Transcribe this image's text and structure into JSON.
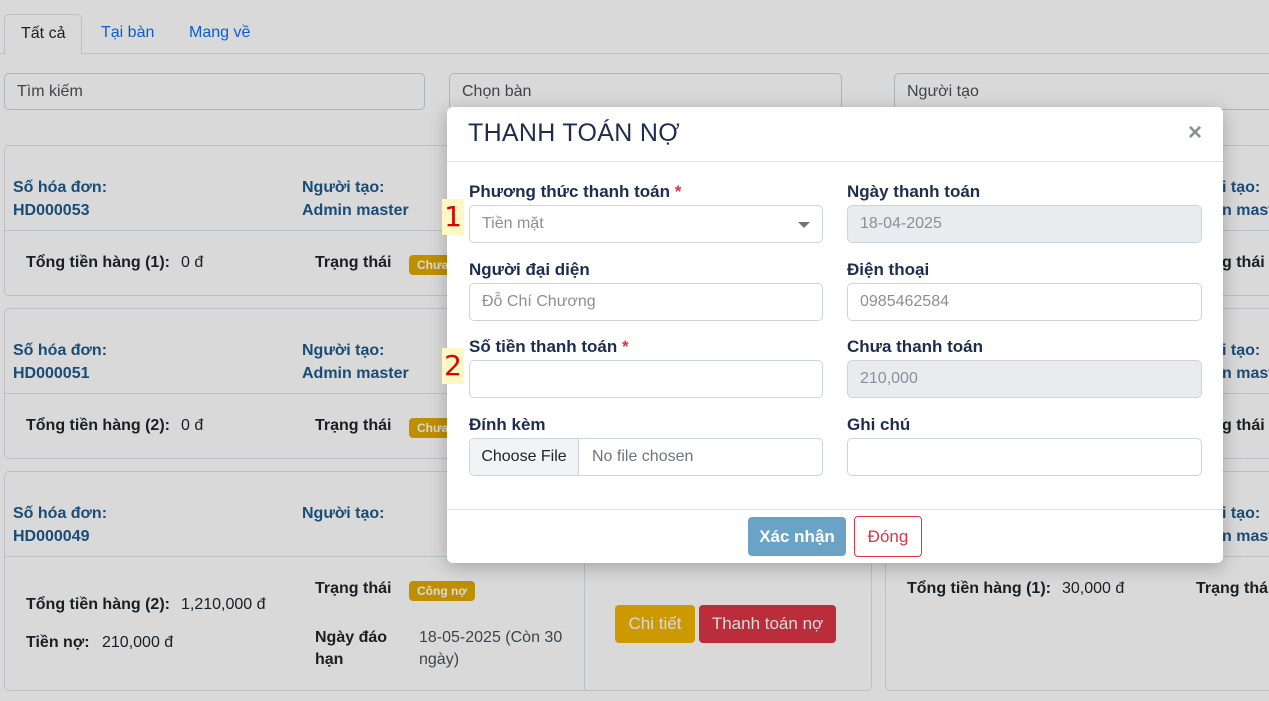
{
  "tabs": [
    "Tất cả",
    "Tại bàn",
    "Mang về"
  ],
  "filters": {
    "search_placeholder": "Tìm kiếm",
    "table_placeholder": "Chọn bàn",
    "creator_placeholder": "Người tạo"
  },
  "cards": [
    {
      "invoice_label": "Số hóa đơn:",
      "invoice_no": "HD000053",
      "creator_label": "Người tạo:",
      "creator": "Admin master",
      "total_label": "Tổng tiền hàng (1):",
      "total": "0 đ",
      "status_label": "Trạng thái",
      "status_badge": "Chưa"
    },
    {
      "invoice_label": "Số hóa đơn:",
      "invoice_no": "HD000051",
      "creator_label": "Người tạo:",
      "creator": "Admin master",
      "total_label": "Tổng tiền hàng (2):",
      "total": "0 đ",
      "status_label": "Trạng thái",
      "status_badge": "Chưa"
    },
    {
      "invoice_label": "Số hóa đơn:",
      "invoice_no": "HD000049",
      "creator_label": "Người tạo:",
      "total_label": "Tổng tiền hàng (2):",
      "total": "1,210,000 đ",
      "debt_label": "Tiền nợ:",
      "debt": "210,000 đ",
      "status_label": "Trạng thái",
      "status_badge": "Công nợ",
      "due_label": "Ngày đáo hạn",
      "due_value": "18-05-2025 (Còn 30 ngày)",
      "detail_button": "Chi tiết",
      "pay_debt_button": "Thanh toán nợ"
    }
  ],
  "right_cards": {
    "creator_label_fragment": "i tạo:",
    "creator_fragment": "n mast",
    "status_fragment": "g thái",
    "total_label": "Tổng tiền hàng (1):",
    "total": "30,000 đ",
    "status_label": "Trạng thái"
  },
  "modal": {
    "title": "THANH TOÁN NỢ",
    "close_symbol": "×",
    "payment_method_label": "Phương thức thanh toán",
    "payment_method_value": "Tiền mặt",
    "payment_date_label": "Ngày thanh toán",
    "payment_date_value": "18-04-2025",
    "representative_label": "Người đại diện",
    "representative_value": "Đỗ Chí Chương",
    "phone_label": "Điện thoại",
    "phone_value": "0985462584",
    "amount_label": "Số tiền thanh toán",
    "amount_value": "",
    "unpaid_label": "Chưa thanh toán",
    "unpaid_value": "210,000",
    "attachment_label": "Đính kèm",
    "choose_file": "Choose File",
    "no_file": "No file chosen",
    "note_label": "Ghi chú",
    "note_value": "",
    "required_mark": "*",
    "confirm_button": "Xác nhận",
    "close_button": "Đóng"
  },
  "markers": [
    "1",
    "2"
  ]
}
